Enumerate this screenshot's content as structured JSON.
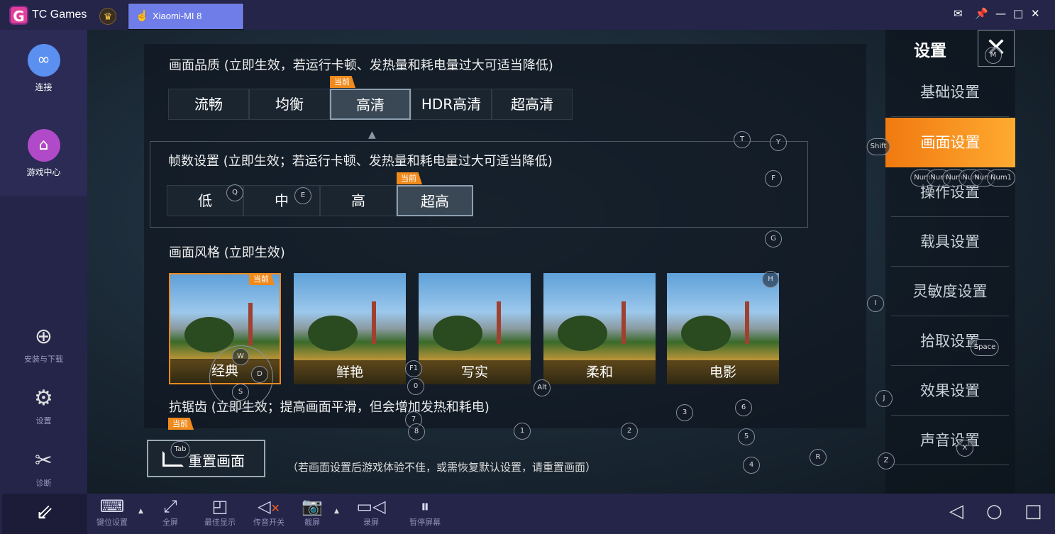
{
  "titlebar": {
    "app_name": "TC Games",
    "logo": "G",
    "device_tab": "Xiaomi-MI 8",
    "icons": [
      "mail-icon",
      "pin-icon",
      "minimize-icon",
      "maximize-icon",
      "close-icon"
    ]
  },
  "sidebar": {
    "items": [
      {
        "label": "连接",
        "icon": "link-icon"
      },
      {
        "label": "游戏中心",
        "icon": "home-icon"
      },
      {
        "label": "安装与下载",
        "icon": "download-icon"
      },
      {
        "label": "设置",
        "icon": "gear-icon"
      },
      {
        "label": "诊断",
        "icon": "tools-icon"
      }
    ]
  },
  "game": {
    "quality": {
      "title": "画面品质 (立即生效，若运行卡顿、发热量和耗电量过大可适当降低)",
      "options": [
        "流畅",
        "均衡",
        "高清",
        "HDR高清",
        "超高清"
      ],
      "selected": "高清"
    },
    "current_badge": "当前",
    "framerate": {
      "title": "帧数设置 (立即生效；若运行卡顿、发热量和耗电量过大可适当降低)",
      "options": [
        "低",
        "中",
        "高",
        "超高"
      ],
      "selected": "超高"
    },
    "style": {
      "title": "画面风格 (立即生效)",
      "options": [
        "经典",
        "鲜艳",
        "写实",
        "柔和",
        "电影"
      ],
      "selected": "经典"
    },
    "antialias": {
      "title": "抗锯齿 (立即生效；提高画面平滑，但会增加发热和耗电)"
    },
    "reset_button": "重置画面",
    "reset_note": "（若画面设置后游戏体验不佳，或需恢复默认设置，请重置画面）",
    "menu": {
      "title": "设置",
      "items": [
        "基础设置",
        "画面设置",
        "操作设置",
        "载具设置",
        "灵敏度设置",
        "拾取设置",
        "效果设置",
        "声音设置"
      ],
      "selected": "画面设置"
    },
    "keymap": [
      "T",
      "Y",
      "F",
      "Q",
      "E",
      "G",
      "H",
      "I",
      "Shift",
      "Num",
      "Num",
      "Num",
      "Num",
      "Num",
      "Num1",
      "Space",
      "W",
      "D",
      "S",
      "F1",
      "0",
      "Alt",
      "7",
      "8",
      "3",
      "6",
      "1",
      "2",
      "5",
      "4",
      "R",
      "Z",
      "J",
      "X",
      "Tab",
      "M"
    ]
  },
  "toolbar": {
    "items": [
      {
        "label": "键位设置",
        "icon": "keyboard-lock-icon"
      },
      {
        "label": "全屏",
        "icon": "fullscreen-icon"
      },
      {
        "label": "最佳显示",
        "icon": "best-fit-icon"
      },
      {
        "label": "传音开关",
        "icon": "speaker-muted-icon"
      },
      {
        "label": "截屏",
        "icon": "camera-icon"
      },
      {
        "label": "录屏",
        "icon": "video-icon"
      },
      {
        "label": "暂停屏幕",
        "icon": "pause-icon"
      }
    ],
    "nav": [
      "back-icon",
      "home-circle-icon",
      "recent-square-icon"
    ]
  }
}
